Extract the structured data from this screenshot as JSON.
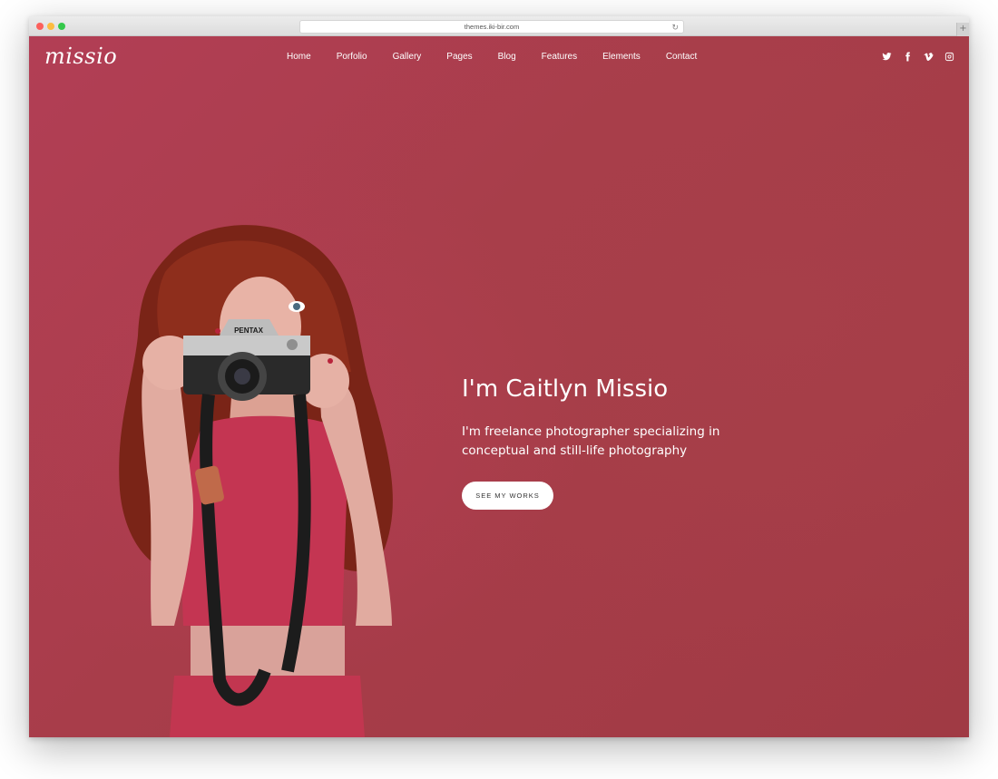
{
  "browser": {
    "url": "themes.iki-bir.com"
  },
  "site": {
    "logo_text": "missio",
    "nav": [
      {
        "label": "Home"
      },
      {
        "label": "Porfolio"
      },
      {
        "label": "Gallery"
      },
      {
        "label": "Pages"
      },
      {
        "label": "Blog"
      },
      {
        "label": "Features"
      },
      {
        "label": "Elements"
      },
      {
        "label": "Contact"
      }
    ],
    "social_icons": [
      "twitter-icon",
      "facebook-icon",
      "vimeo-icon",
      "instagram-icon"
    ]
  },
  "hero": {
    "headline": "I'm Caitlyn Missio",
    "subtitle": "I'm freelance photographer specializing in conceptual and still-life photography",
    "cta_label": "SEE MY WORKS",
    "background_color": "#a53a49",
    "camera_brand": "PENTAX"
  }
}
